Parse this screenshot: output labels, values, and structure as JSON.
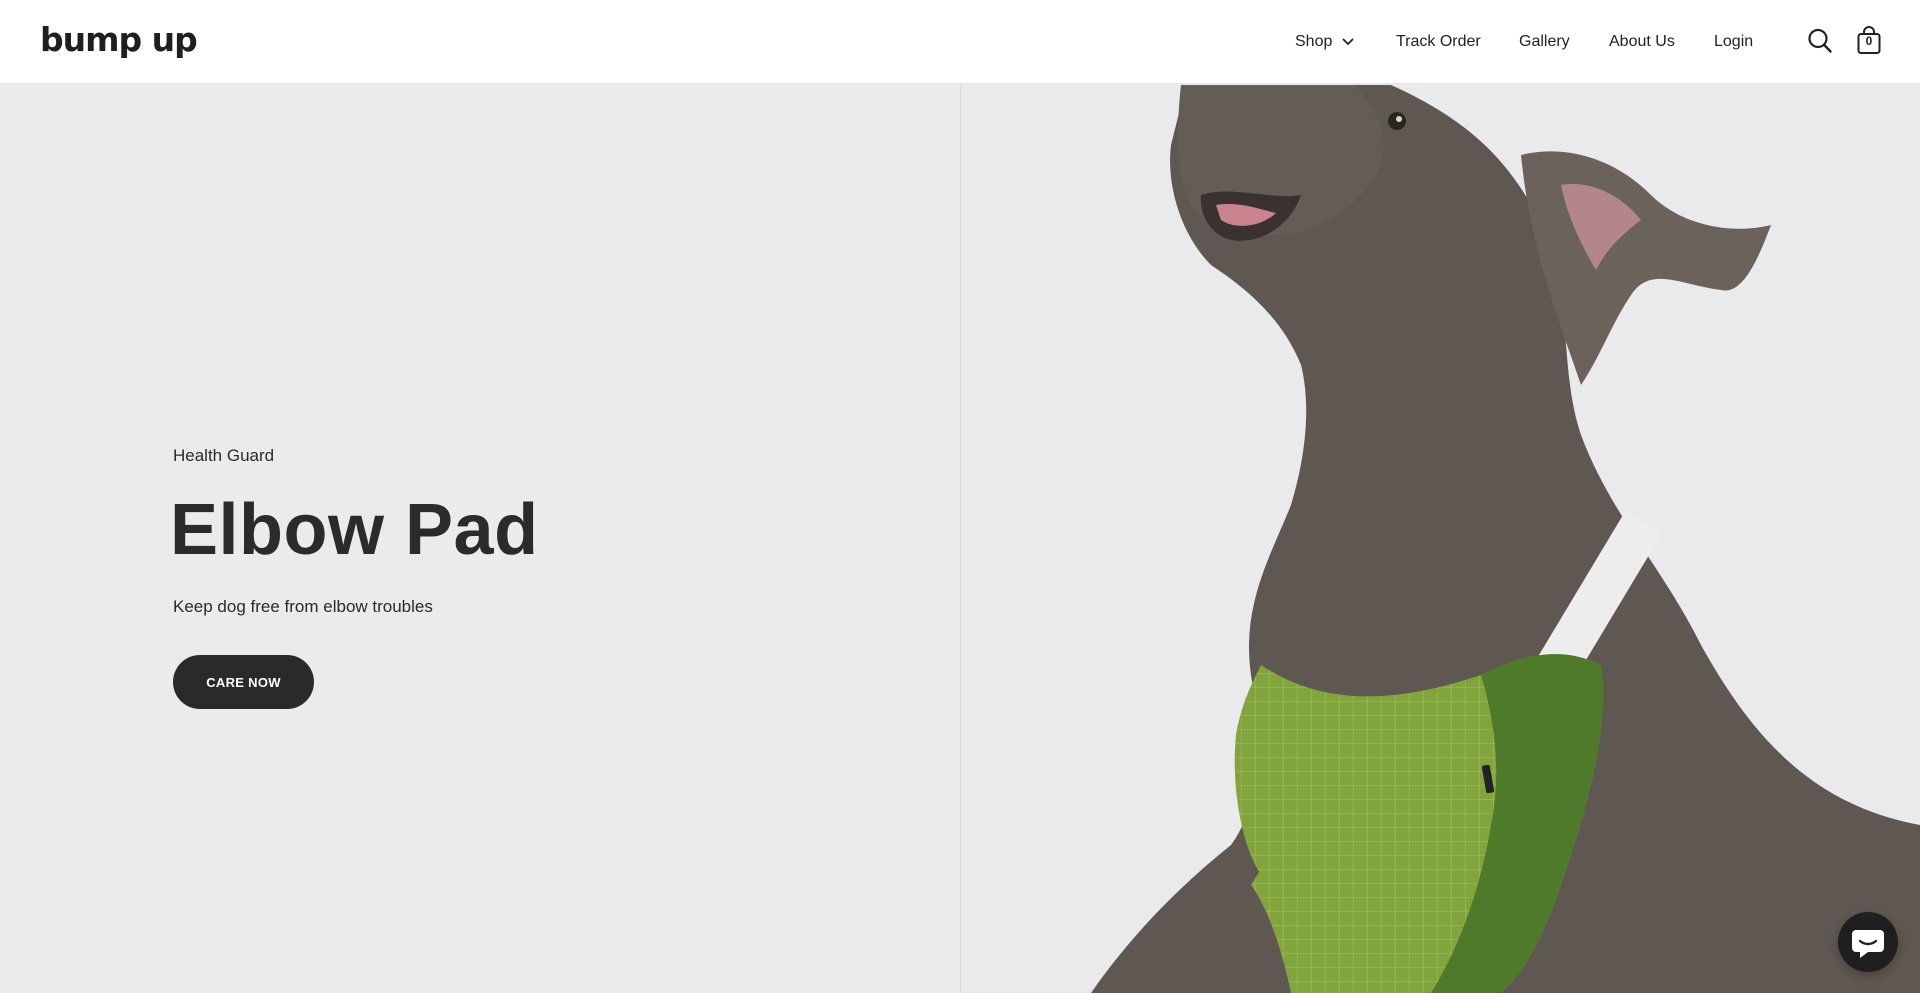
{
  "header": {
    "logo_text": "bump up",
    "nav": {
      "shop": "Shop",
      "track_order": "Track Order",
      "gallery": "Gallery",
      "about_us": "About Us",
      "login": "Login"
    },
    "cart_count": "0"
  },
  "hero": {
    "eyebrow": "Health Guard",
    "title": "Elbow Pad",
    "subtitle": "Keep dog free from elbow troubles",
    "cta_label": "CARE NOW"
  },
  "colors": {
    "background": "#ebebed",
    "button": "#2a2a2a",
    "vest_green": "#7fa03a",
    "vest_dark_green": "#4f7a2a",
    "dog_brown": "#5e5750"
  },
  "icons": [
    "chevron-down-icon",
    "search-icon",
    "shopping-bag-icon",
    "chat-icon"
  ]
}
